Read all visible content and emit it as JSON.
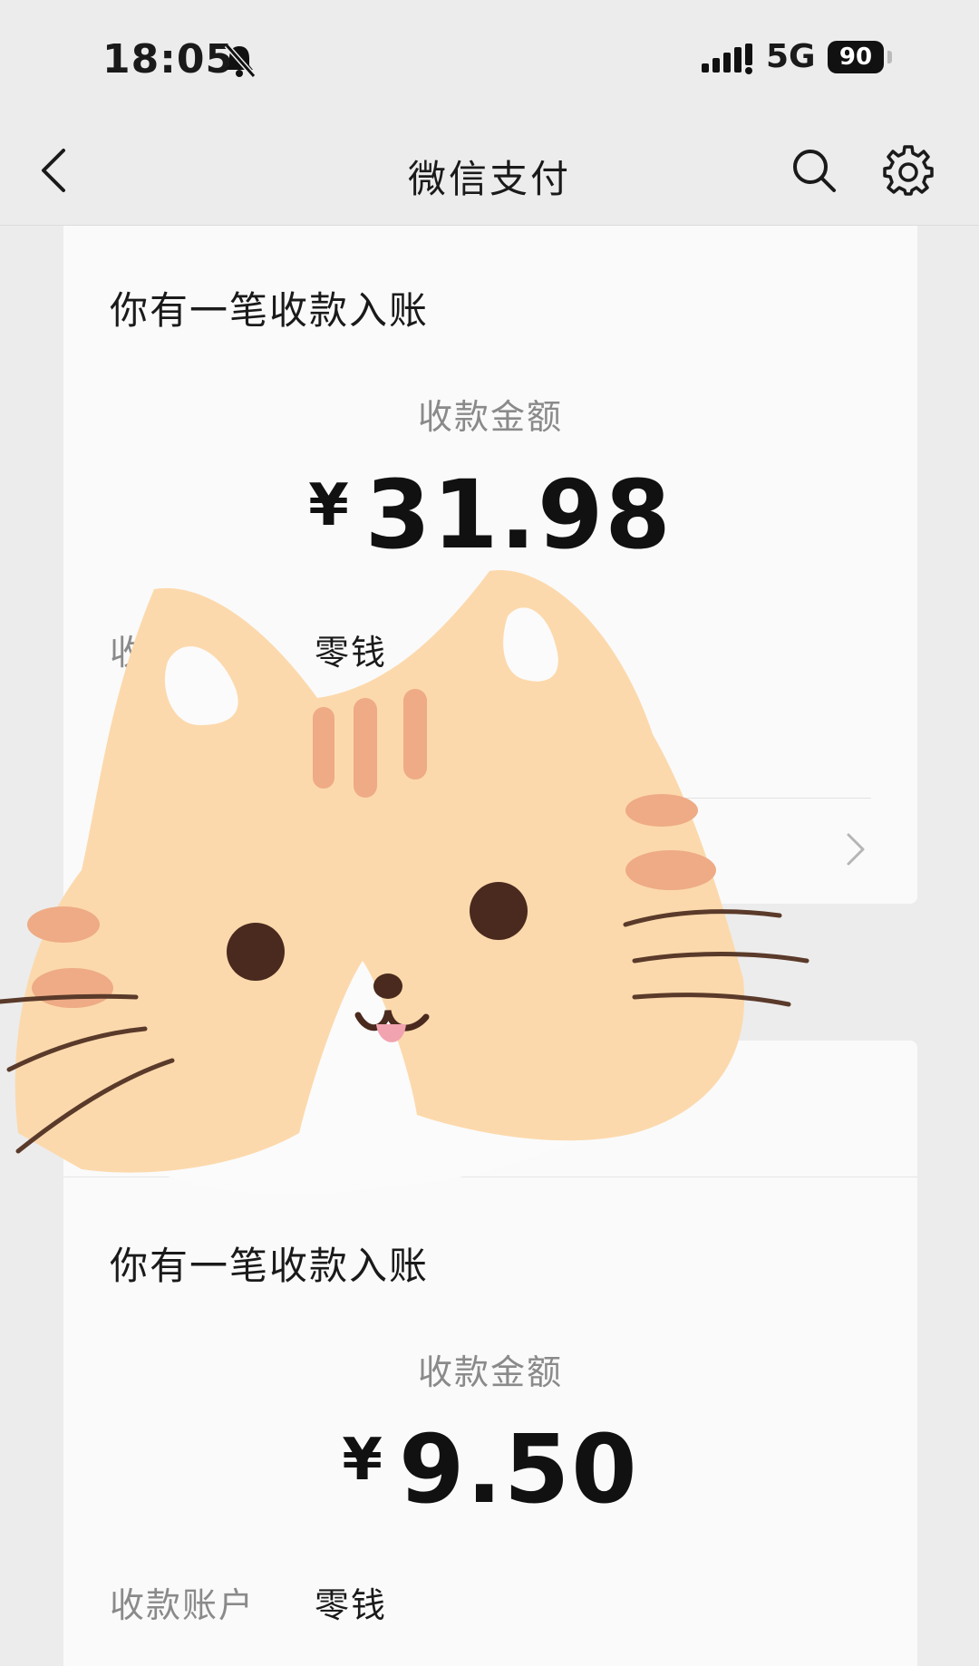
{
  "status_bar": {
    "time": "18:05",
    "network": "5G",
    "battery": "90"
  },
  "nav": {
    "title": "微信支付",
    "icons": [
      "back-arrow-icon",
      "search-icon",
      "gear-icon"
    ]
  },
  "cards": [
    {
      "title": "你有一笔收款入账",
      "amount_label": "收款金额",
      "currency": "¥",
      "amount": "31.98",
      "rows": [
        {
          "label": "收",
          "value": "零钱"
        },
        {
          "label": "",
          "value": ""
        }
      ]
    },
    {
      "title": "你有一笔收款入账",
      "amount_label": "收款金额",
      "currency": "¥",
      "amount": "9.50",
      "rows": [
        {
          "label": "收款账户",
          "value": "零钱"
        }
      ]
    }
  ],
  "colors": {
    "background": "#ececec",
    "card": "#fafafa",
    "cat_fur": "#fcd9ac",
    "cat_stripes": "#eeab85"
  }
}
